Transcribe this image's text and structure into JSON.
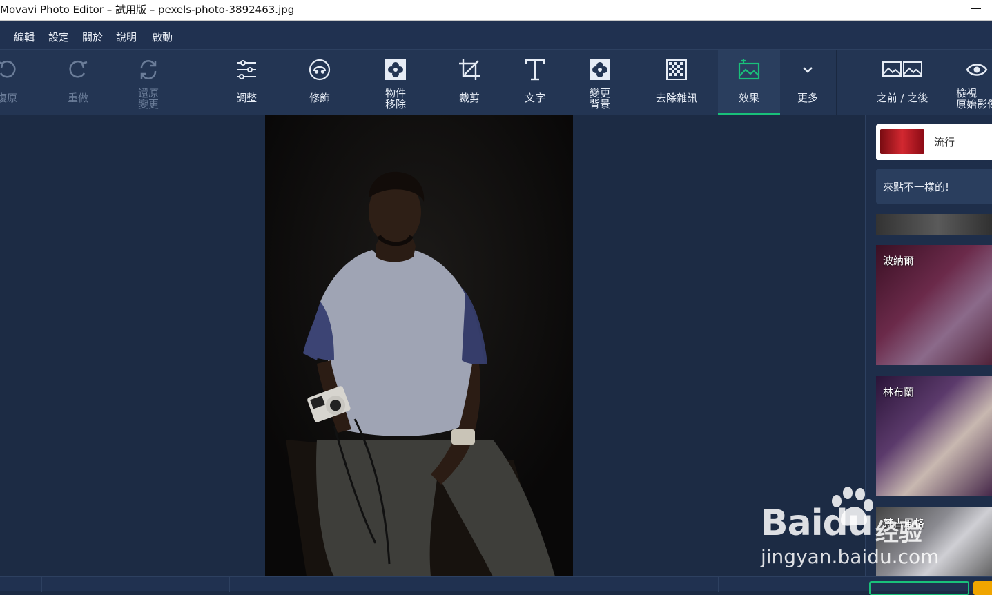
{
  "window": {
    "title": "Movavi Photo Editor – 試用版 – pexels-photo-3892463.jpg"
  },
  "menu": {
    "items": [
      "編輯",
      "設定",
      "關於",
      "說明",
      "啟動"
    ]
  },
  "toolbar": {
    "undo": "復原",
    "redo": "重做",
    "revert": "還原\n變更",
    "adjust": "調整",
    "retouch": "修飾",
    "object_removal": "物件\n移除",
    "crop": "裁剪",
    "text": "文字",
    "change_background": "變更\n背景",
    "denoise": "去除雜訊",
    "effects": "效果",
    "more": "更多",
    "before_after": "之前 / 之後",
    "view_original": "檢視\n原始影像"
  },
  "panel": {
    "category": "流行",
    "promo": "來點不一樣的!",
    "effects": [
      "波納爾",
      "林布蘭",
      "梵古風格"
    ]
  },
  "watermark": {
    "line1": "Baidu",
    "line2": "jingyan.baidu.com",
    "cn": "经验"
  },
  "colors": {
    "accent": "#19c07a",
    "toolbar_bg": "#233553",
    "workspace_bg": "#1c2b44"
  }
}
